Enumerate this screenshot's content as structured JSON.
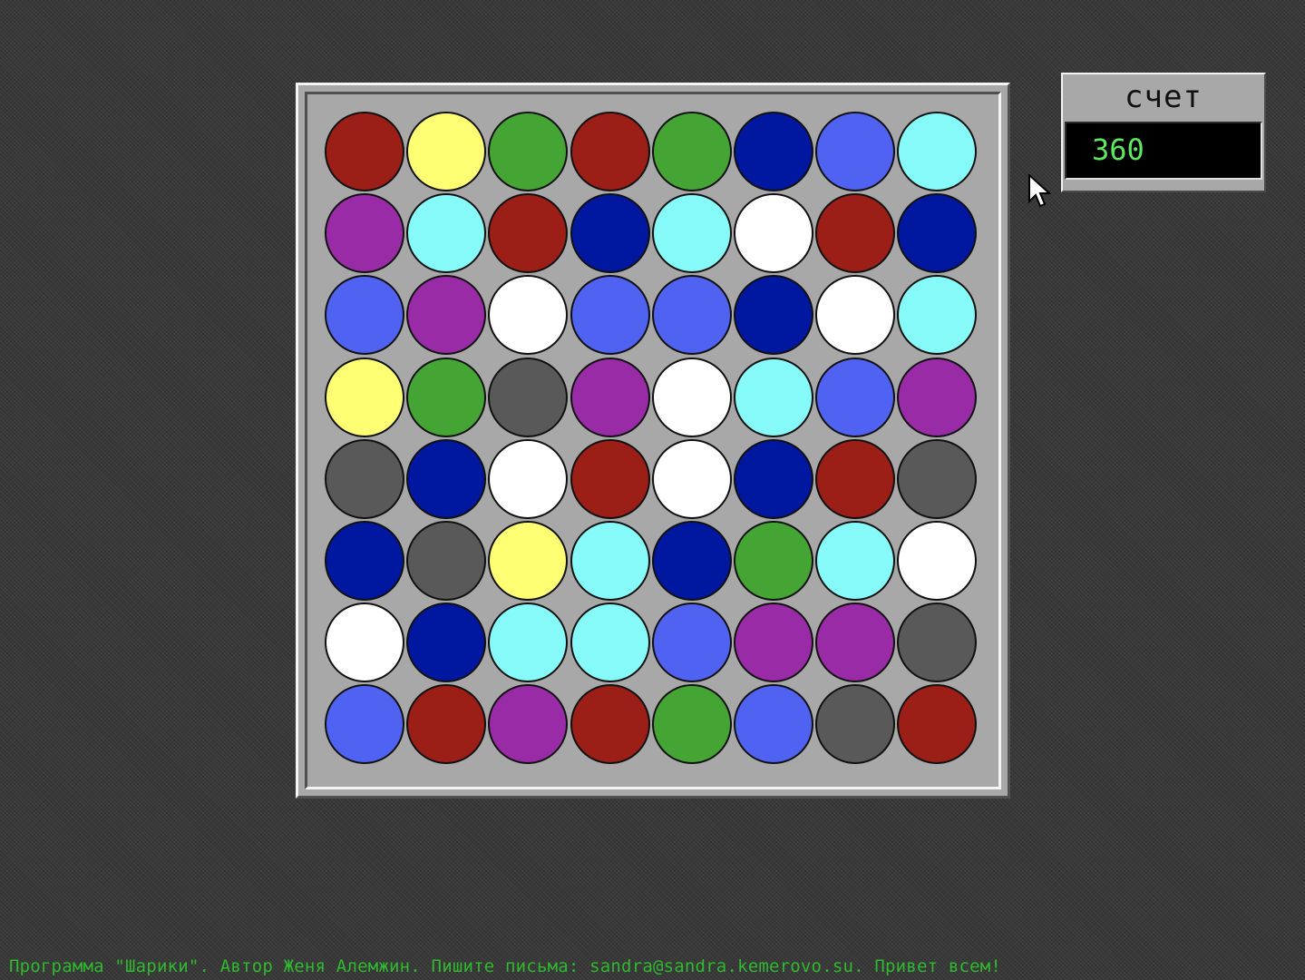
{
  "game_title": "Шарики",
  "score": {
    "label": "счет",
    "value": "360"
  },
  "board": {
    "rows": 8,
    "cols": 8,
    "cells": [
      [
        "red",
        "yellow",
        "green",
        "red",
        "green",
        "navy",
        "blue",
        "cyan"
      ],
      [
        "purple",
        "cyan",
        "red",
        "navy",
        "cyan",
        "white",
        "red",
        "navy"
      ],
      [
        "blue",
        "purple",
        "white",
        "blue",
        "blue",
        "navy",
        "white",
        "cyan"
      ],
      [
        "yellow",
        "green",
        "gray",
        "purple",
        "white",
        "cyan",
        "blue",
        "purple"
      ],
      [
        "gray",
        "navy",
        "white",
        "red",
        "white",
        "navy",
        "red",
        "gray"
      ],
      [
        "navy",
        "gray",
        "yellow",
        "cyan",
        "navy",
        "green",
        "cyan",
        "white"
      ],
      [
        "white",
        "navy",
        "cyan",
        "cyan",
        "blue",
        "purple",
        "purple",
        "gray"
      ],
      [
        "blue",
        "red",
        "purple",
        "red",
        "green",
        "blue",
        "gray",
        "red"
      ]
    ]
  },
  "colors": {
    "red": "#9b1e17",
    "yellow": "#ffff73",
    "green": "#45a534",
    "navy": "#0017a0",
    "blue": "#5062f2",
    "cyan": "#86f9f9",
    "purple": "#9a2ba6",
    "white": "#ffffff",
    "gray": "#595959",
    "accent_green": "#5ee85e",
    "footer_green": "#2fb92f",
    "board_bg": "#a8a8a8",
    "desktop_bg": "#383838"
  },
  "cursor_icon": "arrow-pointer-icon",
  "footer": {
    "text": "Программа \"Шарики\". Автор Женя Алемжин. Пишите письма: sandra@sandra.kemerovo.su. Привет всем!"
  }
}
